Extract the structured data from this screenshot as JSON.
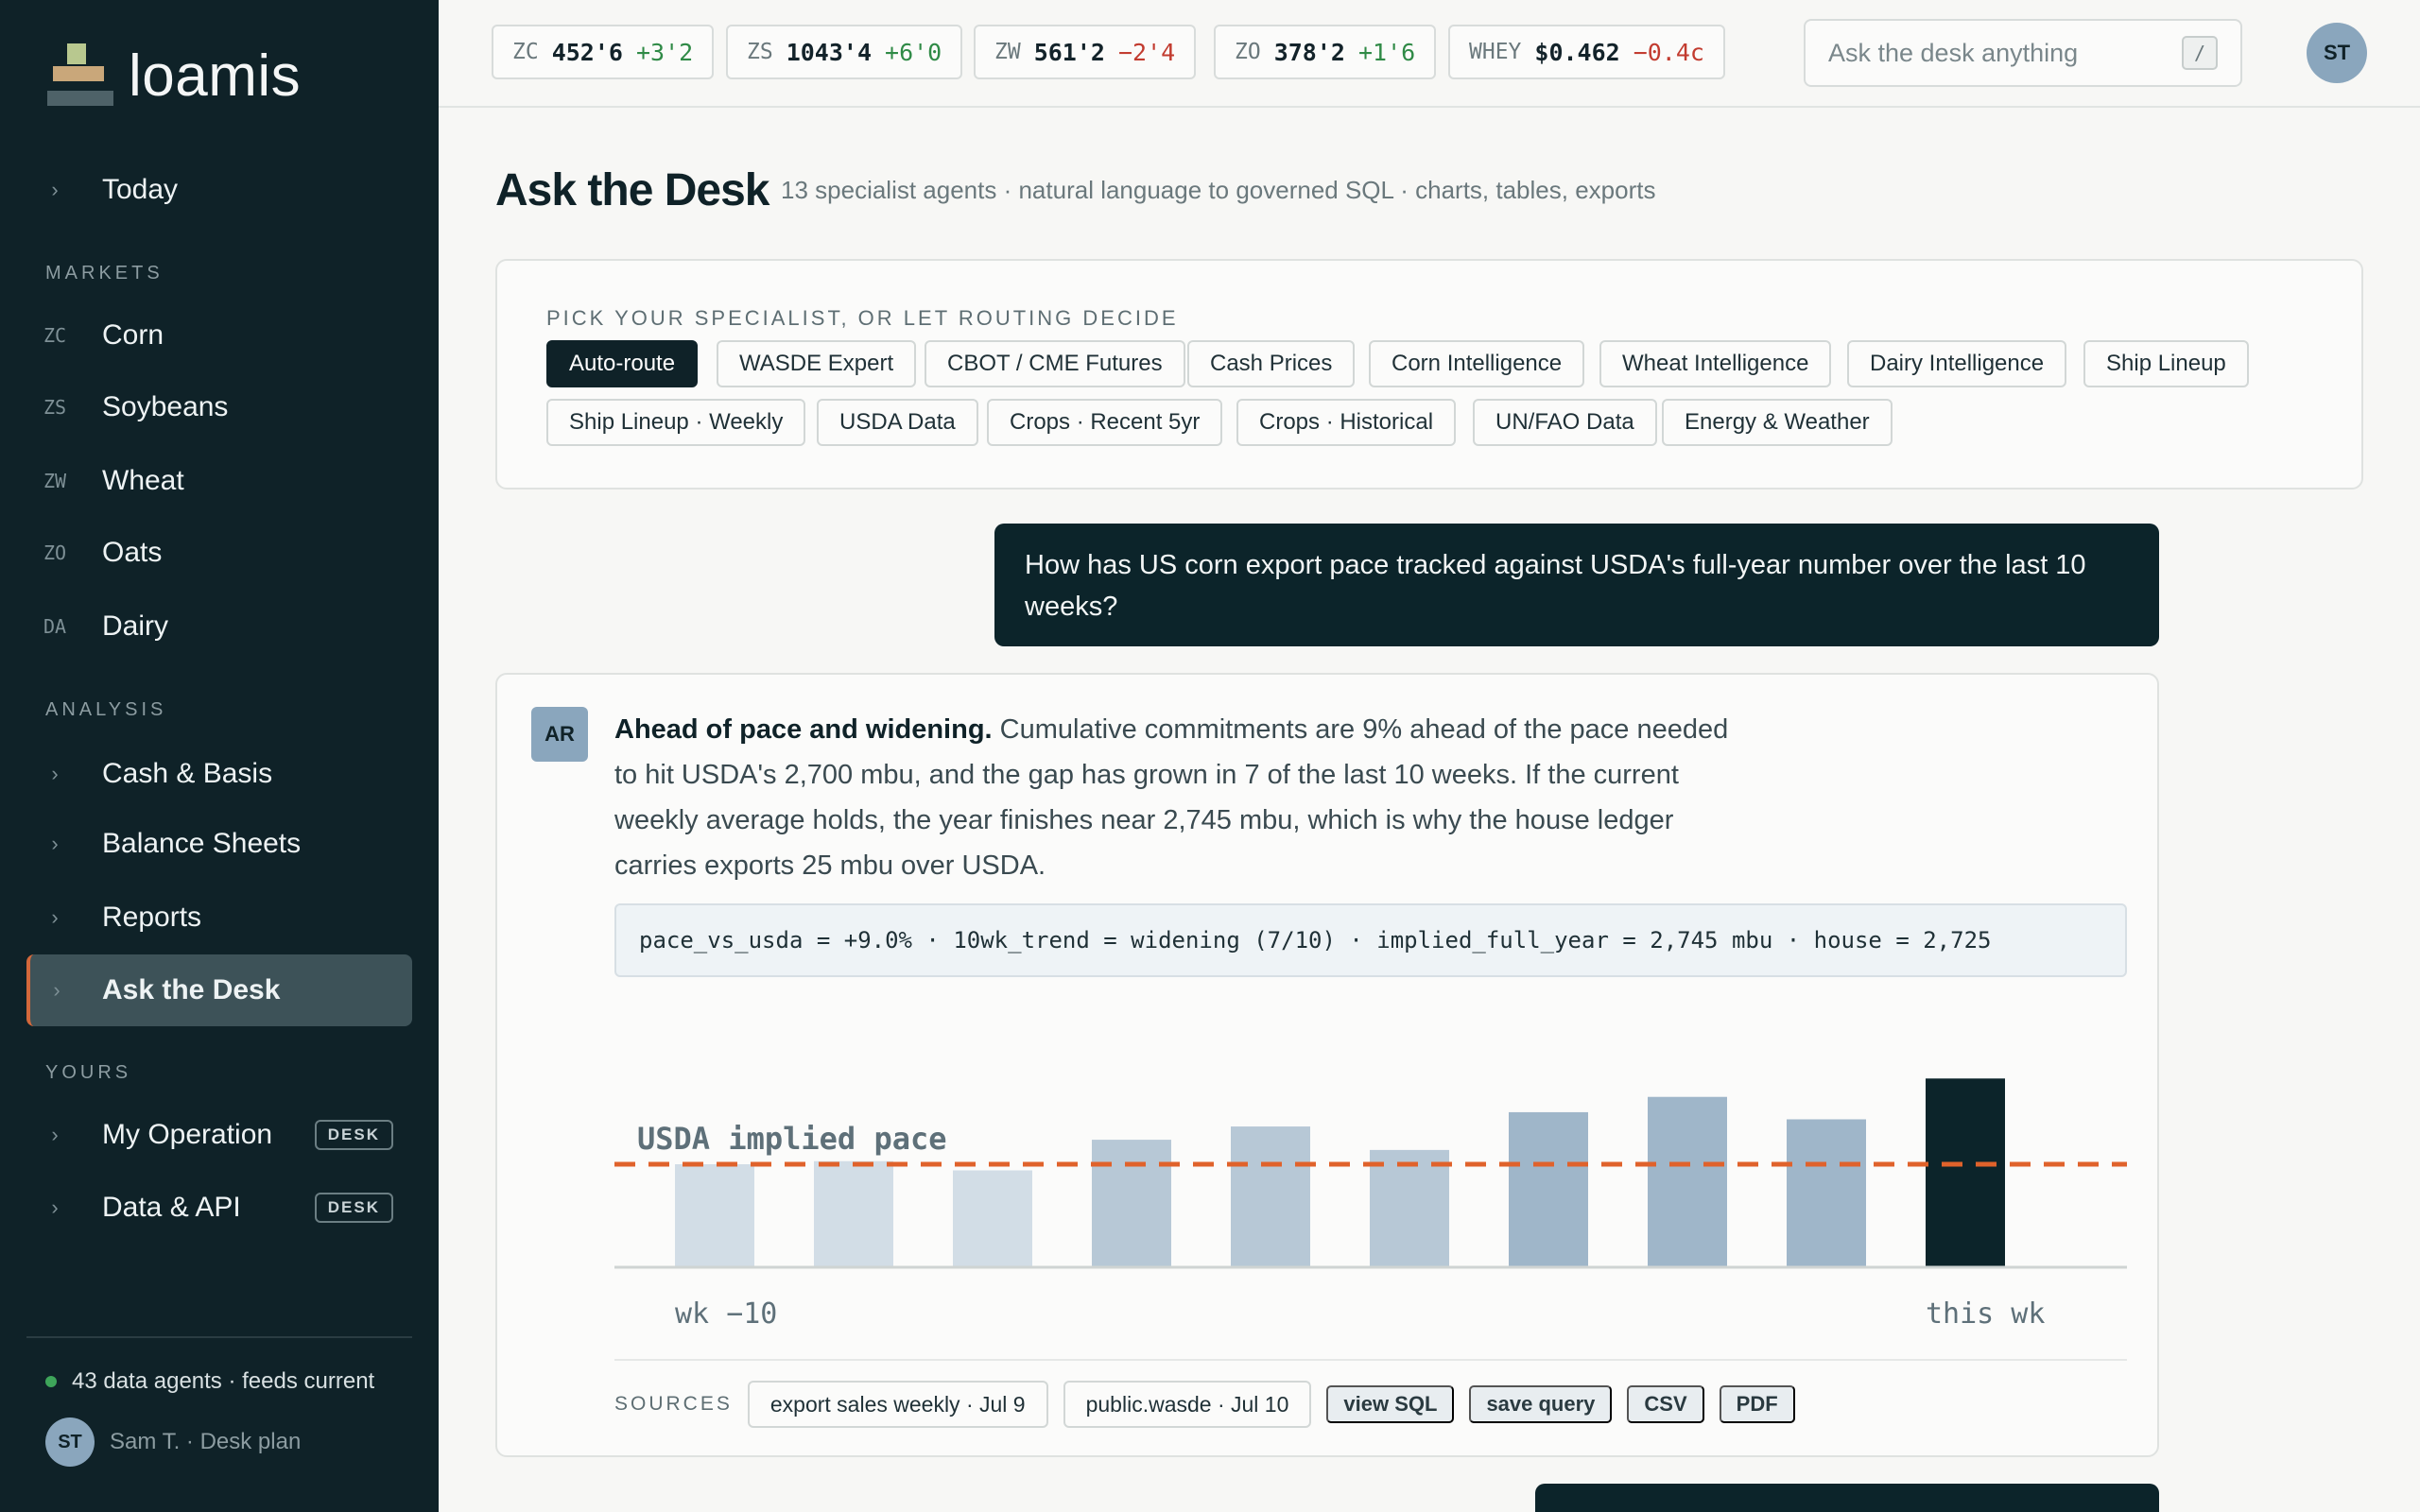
{
  "brand": {
    "name": "loamis"
  },
  "sidebar": {
    "today": "Today",
    "markets_label": "MARKETS",
    "markets": [
      {
        "code": "ZC",
        "label": "Corn"
      },
      {
        "code": "ZS",
        "label": "Soybeans"
      },
      {
        "code": "ZW",
        "label": "Wheat"
      },
      {
        "code": "ZO",
        "label": "Oats"
      },
      {
        "code": "DA",
        "label": "Dairy"
      }
    ],
    "analysis_label": "ANALYSIS",
    "analysis": [
      {
        "label": "Cash & Basis"
      },
      {
        "label": "Balance Sheets"
      },
      {
        "label": "Reports"
      },
      {
        "label": "Ask the Desk"
      }
    ],
    "yours_label": "YOURS",
    "yours": [
      {
        "label": "My Operation",
        "badge": "DESK"
      },
      {
        "label": "Data & API",
        "badge": "DESK"
      }
    ],
    "status": "43 data agents · feeds current",
    "user_initials": "ST",
    "user": "Sam T. · Desk plan"
  },
  "tickers": [
    {
      "sym": "ZC",
      "px": "452'6",
      "chg": "+3'2",
      "dir": "up"
    },
    {
      "sym": "ZS",
      "px": "1043'4",
      "chg": "+6'0",
      "dir": "up"
    },
    {
      "sym": "ZW",
      "px": "561'2",
      "chg": "−2'4",
      "dir": "dn"
    },
    {
      "sym": "ZO",
      "px": "378'2",
      "chg": "+1'6",
      "dir": "up"
    },
    {
      "sym": "WHEY",
      "px": "$0.462",
      "chg": "−0.4c",
      "dir": "dn"
    }
  ],
  "search": {
    "placeholder": "Ask the desk anything",
    "shortcut": "/"
  },
  "header_user_initials": "ST",
  "page": {
    "title": "Ask the Desk",
    "subtitle": "13 specialist agents · natural language to governed SQL · charts, tables, exports"
  },
  "specialists": {
    "label": "PICK YOUR SPECIALIST, OR LET ROUTING DECIDE",
    "chips": [
      "Auto-route",
      "WASDE Expert",
      "CBOT / CME Futures",
      "Cash Prices",
      "Corn Intelligence",
      "Wheat Intelligence",
      "Dairy Intelligence",
      "Ship Lineup",
      "Ship Lineup · Weekly",
      "USDA Data",
      "Crops · Recent 5yr",
      "Crops · Historical",
      "UN/FAO Data",
      "Energy & Weather"
    ],
    "selected": "Auto-route"
  },
  "question": "How has US corn export pace tracked against USDA's full-year number over the last 10 weeks?",
  "answer": {
    "badge": "AR",
    "headline": "Ahead of pace and widening.",
    "body": " Cumulative commitments are 9% ahead of the pace needed to hit USDA's 2,700 mbu, and the gap has grown in 7 of the last 10 weeks. If the current weekly average holds, the year finishes near 2,745 mbu, which is why the house ledger carries exports 25 mbu over USDA.",
    "metrics": "pace_vs_usda = +9.0% · 10wk_trend = widening (7/10) · implied_full_year = 2,745 mbu · house = 2,725",
    "sources_label": "SOURCES",
    "sources": [
      "export sales weekly · Jul 9",
      "public.wasde · Jul 10"
    ],
    "actions": [
      "view SQL",
      "save query",
      "CSV",
      "PDF"
    ]
  },
  "chart_data": {
    "type": "bar",
    "categories": [
      "wk −10",
      "",
      "",
      "",
      "",
      "",
      "",
      "",
      "",
      "this wk"
    ],
    "values": [
      100,
      103,
      94,
      124,
      137,
      114,
      151,
      166,
      144,
      184
    ],
    "reference_line": {
      "label": "USDA implied pace",
      "value": 100,
      "color": "#e0622b"
    },
    "ylim": [
      0,
      200
    ],
    "bar_colors": [
      "#d2dde6",
      "#d2dde6",
      "#d2dde6",
      "#b7c8d6",
      "#b7c8d6",
      "#b7c8d6",
      "#9fb6c9",
      "#9fb6c9",
      "#9fb6c9",
      "#0c242a"
    ],
    "xlabel": "",
    "ylabel": "",
    "grid": false
  },
  "colors": {
    "sidebar_bg": "#0f2228",
    "accent": "#d3683b",
    "up": "#2f8a46",
    "down": "#c23b2f"
  }
}
